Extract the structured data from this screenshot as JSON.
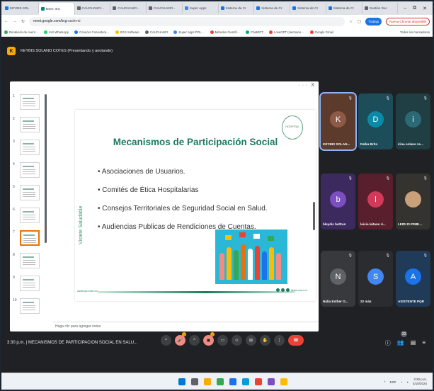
{
  "browser": {
    "tabs": [
      {
        "label": "KEYBIS SOL",
        "fav_color": "#1a73e8",
        "active": false
      },
      {
        "label": "Meet: IKS",
        "fav_color": "#00897b",
        "active": true
      },
      {
        "label": "CAUCHANCI…",
        "fav_color": "#5f6368",
        "active": false
      },
      {
        "label": "CAUCHANCI…",
        "fav_color": "#5f6368",
        "active": false
      },
      {
        "label": "CAUCHANCI…",
        "fav_color": "#5f6368",
        "active": false
      },
      {
        "label": "Super Apps",
        "fav_color": "#4285f4",
        "active": false
      },
      {
        "label": "Sistema de Cr",
        "fav_color": "#1a73e8",
        "active": false
      },
      {
        "label": "Sistema de Cr",
        "fav_color": "#1a73e8",
        "active": false
      },
      {
        "label": "Sistema de Cr",
        "fav_color": "#1a73e8",
        "active": false
      },
      {
        "label": "Sistema de Cr",
        "fav_color": "#1a73e8",
        "active": false
      },
      {
        "label": "Gestión Doc",
        "fav_color": "#5f6368",
        "active": false
      }
    ],
    "url": "meet.google.com/kcg-ccch-rci",
    "profile_label": "Trabajo",
    "error_label": "Nueva Chrome disponible",
    "bookmarks": [
      {
        "label": "Rendición de cuent…",
        "color": "#34a853"
      },
      {
        "label": "IAS WhatsApp",
        "color": "#25d366"
      },
      {
        "label": "Conocer Consultora…",
        "color": "#1a73e8"
      },
      {
        "label": "SGS Software",
        "color": "#fbbc05"
      },
      {
        "label": "CAUCHANCI",
        "color": "#5f6368"
      },
      {
        "label": "Super Apps POL…",
        "color": "#4285f4"
      },
      {
        "label": "Métodos Científi…",
        "color": "#ea4335"
      },
      {
        "label": "ChatGPT",
        "color": "#10a37f"
      },
      {
        "label": "LoveGPT (Hermano…",
        "color": "#ea4335"
      },
      {
        "label": "Google Gmail",
        "color": "#ea4335"
      }
    ],
    "all_bookmarks": "Todos los marcadores"
  },
  "meet": {
    "presenter_icon": "K",
    "presenter_text": "KEYBIS SOLANO COTES (Presentando y anotando)",
    "slide_panel_menu": "··· X",
    "thumbnail_numbers": [
      "1",
      "2",
      "3",
      "4",
      "5",
      "6",
      "7",
      "8",
      "9",
      "10"
    ],
    "selected_slide": 7,
    "slide": {
      "title": "Mecanismos de Participación Social",
      "items": [
        "• Asociaciones de Usuarios.",
        "• Comités de Ética Hospitalarias",
        "• Consejos Territoriales de Seguridad Social en Salud.",
        "• Audiencias Publicas de Rendiciones de Cuentas."
      ],
      "logo_text": "HOSPITAL",
      "vertical_brand": "Vistete Saludable",
      "footer_left": "www.ips.com.co",
      "footer_right": "@ips.com.co"
    },
    "notes_placeholder": "Haga clic para agregar notas",
    "participants": [
      {
        "initial": "K",
        "name": "KEYBIS SOLAN...",
        "bg": "#5c3a2c",
        "avatar": "#8d5a47",
        "speaking": true
      },
      {
        "initial": "D",
        "name": "Delka Brito",
        "bg": "#1e4d5a",
        "avatar": "#0b8aa8",
        "speaking": false
      },
      {
        "initial": "i",
        "name": "irina solano za…",
        "bg": "#1f3f44",
        "avatar": "#2b6a74",
        "speaking": false
      },
      {
        "initial": "b",
        "name": "bleydis beltran",
        "bg": "#3c2a5e",
        "avatar": "#7b4fc2",
        "speaking": false
      },
      {
        "initial": "l",
        "name": "leicia laitano ri...",
        "bg": "#5a1f2c",
        "avatar": "#d23a5a",
        "speaking": false
      },
      {
        "initial": "",
        "name": "LEIDI DI PIME…",
        "bg": "#34332f",
        "avatar": "#c9a07a",
        "speaking": false
      },
      {
        "initial": "N",
        "name": "Nidia Esther O...",
        "bg": "#37393d",
        "avatar": "#5f6368",
        "speaking": false
      },
      {
        "initial": "S",
        "name": "22 más",
        "bg": "#2b2c2f",
        "avatar": "#4285f4",
        "speaking": false
      },
      {
        "initial": "A",
        "name": "ASISTENTE PQR",
        "bg": "#1f3b57",
        "avatar": "#1a73e8",
        "speaking": false
      }
    ],
    "meeting_time": "3:30 p.m.",
    "meeting_title": "MECANISMOS DE PARTICIPACION SOCIAL EN SALU...",
    "participant_count": "33",
    "controls": [
      {
        "name": "mic-options",
        "glyph": "^",
        "warn": false,
        "badge": false
      },
      {
        "name": "mic",
        "glyph": "🎤",
        "warn": true,
        "badge": true
      },
      {
        "name": "camera-options",
        "glyph": "^",
        "warn": false,
        "badge": false
      },
      {
        "name": "camera",
        "glyph": "▣",
        "warn": true,
        "badge": true
      },
      {
        "name": "captions",
        "glyph": "▭",
        "warn": false,
        "badge": false
      },
      {
        "name": "emoji",
        "glyph": "☺",
        "warn": false,
        "badge": false
      },
      {
        "name": "present",
        "glyph": "⊞",
        "warn": false,
        "badge": false
      },
      {
        "name": "raise-hand",
        "glyph": "✋",
        "warn": false,
        "badge": false
      },
      {
        "name": "more",
        "glyph": "⋮",
        "warn": false,
        "badge": false
      },
      {
        "name": "leave",
        "glyph": "☎",
        "warn": false,
        "badge": false,
        "red": true
      }
    ]
  },
  "taskbar": {
    "apps": [
      {
        "name": "start",
        "color": "#0078d4"
      },
      {
        "name": "search",
        "color": "#5f6368"
      },
      {
        "name": "files",
        "color": "#f9ab00"
      },
      {
        "name": "chrome",
        "color": "#34a853"
      },
      {
        "name": "store",
        "color": "#1a73e8"
      },
      {
        "name": "edge",
        "color": "#0c9bd8"
      },
      {
        "name": "teams",
        "color": "#ea4335"
      },
      {
        "name": "photos",
        "color": "#7b4fc2"
      },
      {
        "name": "app9",
        "color": "#fbbc05"
      }
    ],
    "lang": "ESP",
    "time": "3:30 p.m.",
    "date": "4/10/2024"
  }
}
